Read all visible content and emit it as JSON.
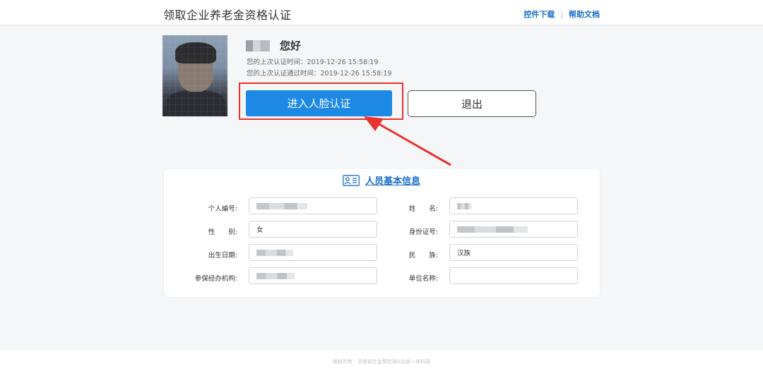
{
  "header": {
    "title": "领取企业养老金资格认证",
    "links": [
      "控件下载",
      "帮助文档"
    ]
  },
  "profile": {
    "greeting": "您好",
    "last_auth_time": "您的上次认证时间：2019-12-26 15:58:19",
    "last_pass_time": "您的上次认证通过时间：2019-12-26 15:58:19"
  },
  "actions": {
    "face_auth": "进入人脸认证",
    "logout": "退出"
  },
  "info": {
    "title": "人员基本信息",
    "fields": {
      "personal_no_label": "个人编号:",
      "name_label": "姓　　名:",
      "gender_label": "性　　别:",
      "gender_value": "女",
      "id_label": "身份证号:",
      "birth_label": "出生日期:",
      "ethnicity_label": "民　　族:",
      "ethnicity_value": "汉族",
      "agency_label": "参保经办机构:",
      "employer_label": "单位名称:",
      "employer_value": ""
    }
  },
  "footer": {
    "copyright": "版权所有：河南省社会保险局&北京一体科技"
  },
  "colors": {
    "accent": "#1e88e5",
    "highlight": "#e8322b",
    "link": "#1a6fc9"
  },
  "icons": [
    "id-card-icon",
    "red-arrow-icon"
  ]
}
